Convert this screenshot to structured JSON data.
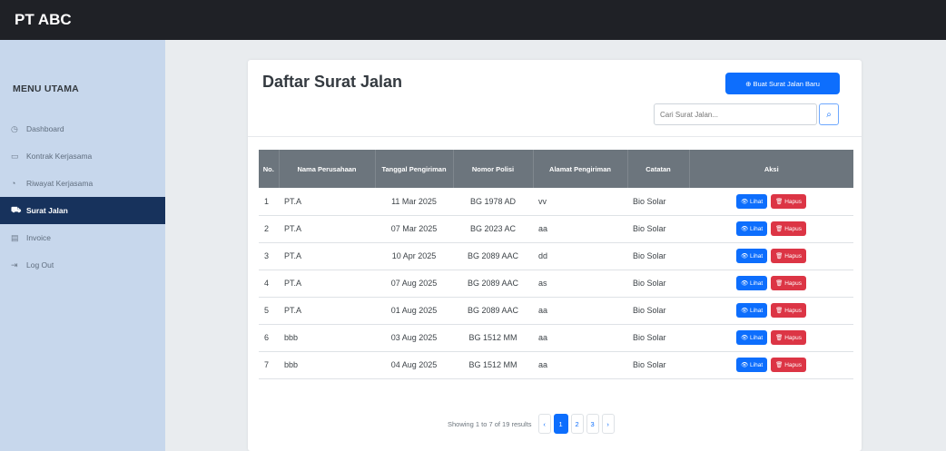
{
  "app": {
    "brand": "PT ABC"
  },
  "sidebar": {
    "heading": "MENU UTAMA",
    "items": [
      {
        "icon": "dashboard-icon",
        "glyph": "◷",
        "label": "Dashboard",
        "active": false
      },
      {
        "icon": "document-icon",
        "glyph": "▭",
        "label": "Kontrak Kerjasama",
        "active": false
      },
      {
        "icon": "clock-icon",
        "glyph": "◔",
        "label": "Riwayat Kerjasama",
        "active": false
      },
      {
        "icon": "truck-icon",
        "glyph": "⛟",
        "label": "Surat Jalan",
        "active": true
      },
      {
        "icon": "invoice-icon",
        "glyph": "▤",
        "label": "Invoice",
        "active": false
      },
      {
        "icon": "logout-icon",
        "glyph": "⇥",
        "label": "Log Out",
        "active": false
      }
    ]
  },
  "page": {
    "title": "Daftar Surat Jalan",
    "new_button": "⊕ Buat Surat Jalan Baru",
    "search_placeholder": "Cari Surat Jalan...",
    "search_glyph": "⌕"
  },
  "table": {
    "headers": [
      "No.",
      "Nama Perusahaan",
      "Tanggal Pengiriman",
      "Nomor Polisi",
      "Alamat Pengiriman",
      "Catatan",
      "Aksi"
    ],
    "view_label": "👁 Lihat",
    "delete_label": "🗑 Hapus",
    "rows": [
      [
        "1",
        "PT.A",
        "11 Mar 2025",
        "BG 1978 AD",
        "vv",
        "Bio Solar"
      ],
      [
        "2",
        "PT.A",
        "07 Mar 2025",
        "BG 2023 AC",
        "aa",
        "Bio Solar"
      ],
      [
        "3",
        "PT.A",
        "10 Apr 2025",
        "BG 2089 AAC",
        "dd",
        "Bio Solar"
      ],
      [
        "4",
        "PT.A",
        "07 Aug 2025",
        "BG 2089 AAC",
        "as",
        "Bio Solar"
      ],
      [
        "5",
        "PT.A",
        "01 Aug 2025",
        "BG 2089 AAC",
        "aa",
        "Bio Solar"
      ],
      [
        "6",
        "bbb",
        "03 Aug 2025",
        "BG 1512 MM",
        "aa",
        "Bio Solar"
      ],
      [
        "7",
        "bbb",
        "04 Aug 2025",
        "BG 1512 MM",
        "aa",
        "Bio Solar"
      ]
    ]
  },
  "pagination": {
    "info": "Showing 1 to 7 of 19 results",
    "prev": "‹",
    "pages": [
      "1",
      "2",
      "3"
    ],
    "active_page": "1",
    "next": "›"
  },
  "colors": {
    "topbar": "#1f2126",
    "sidebar": "#c7d7ec",
    "active_nav": "#17325c",
    "primary": "#0d6efd",
    "danger": "#dc3545",
    "table_header": "#6c757d"
  }
}
